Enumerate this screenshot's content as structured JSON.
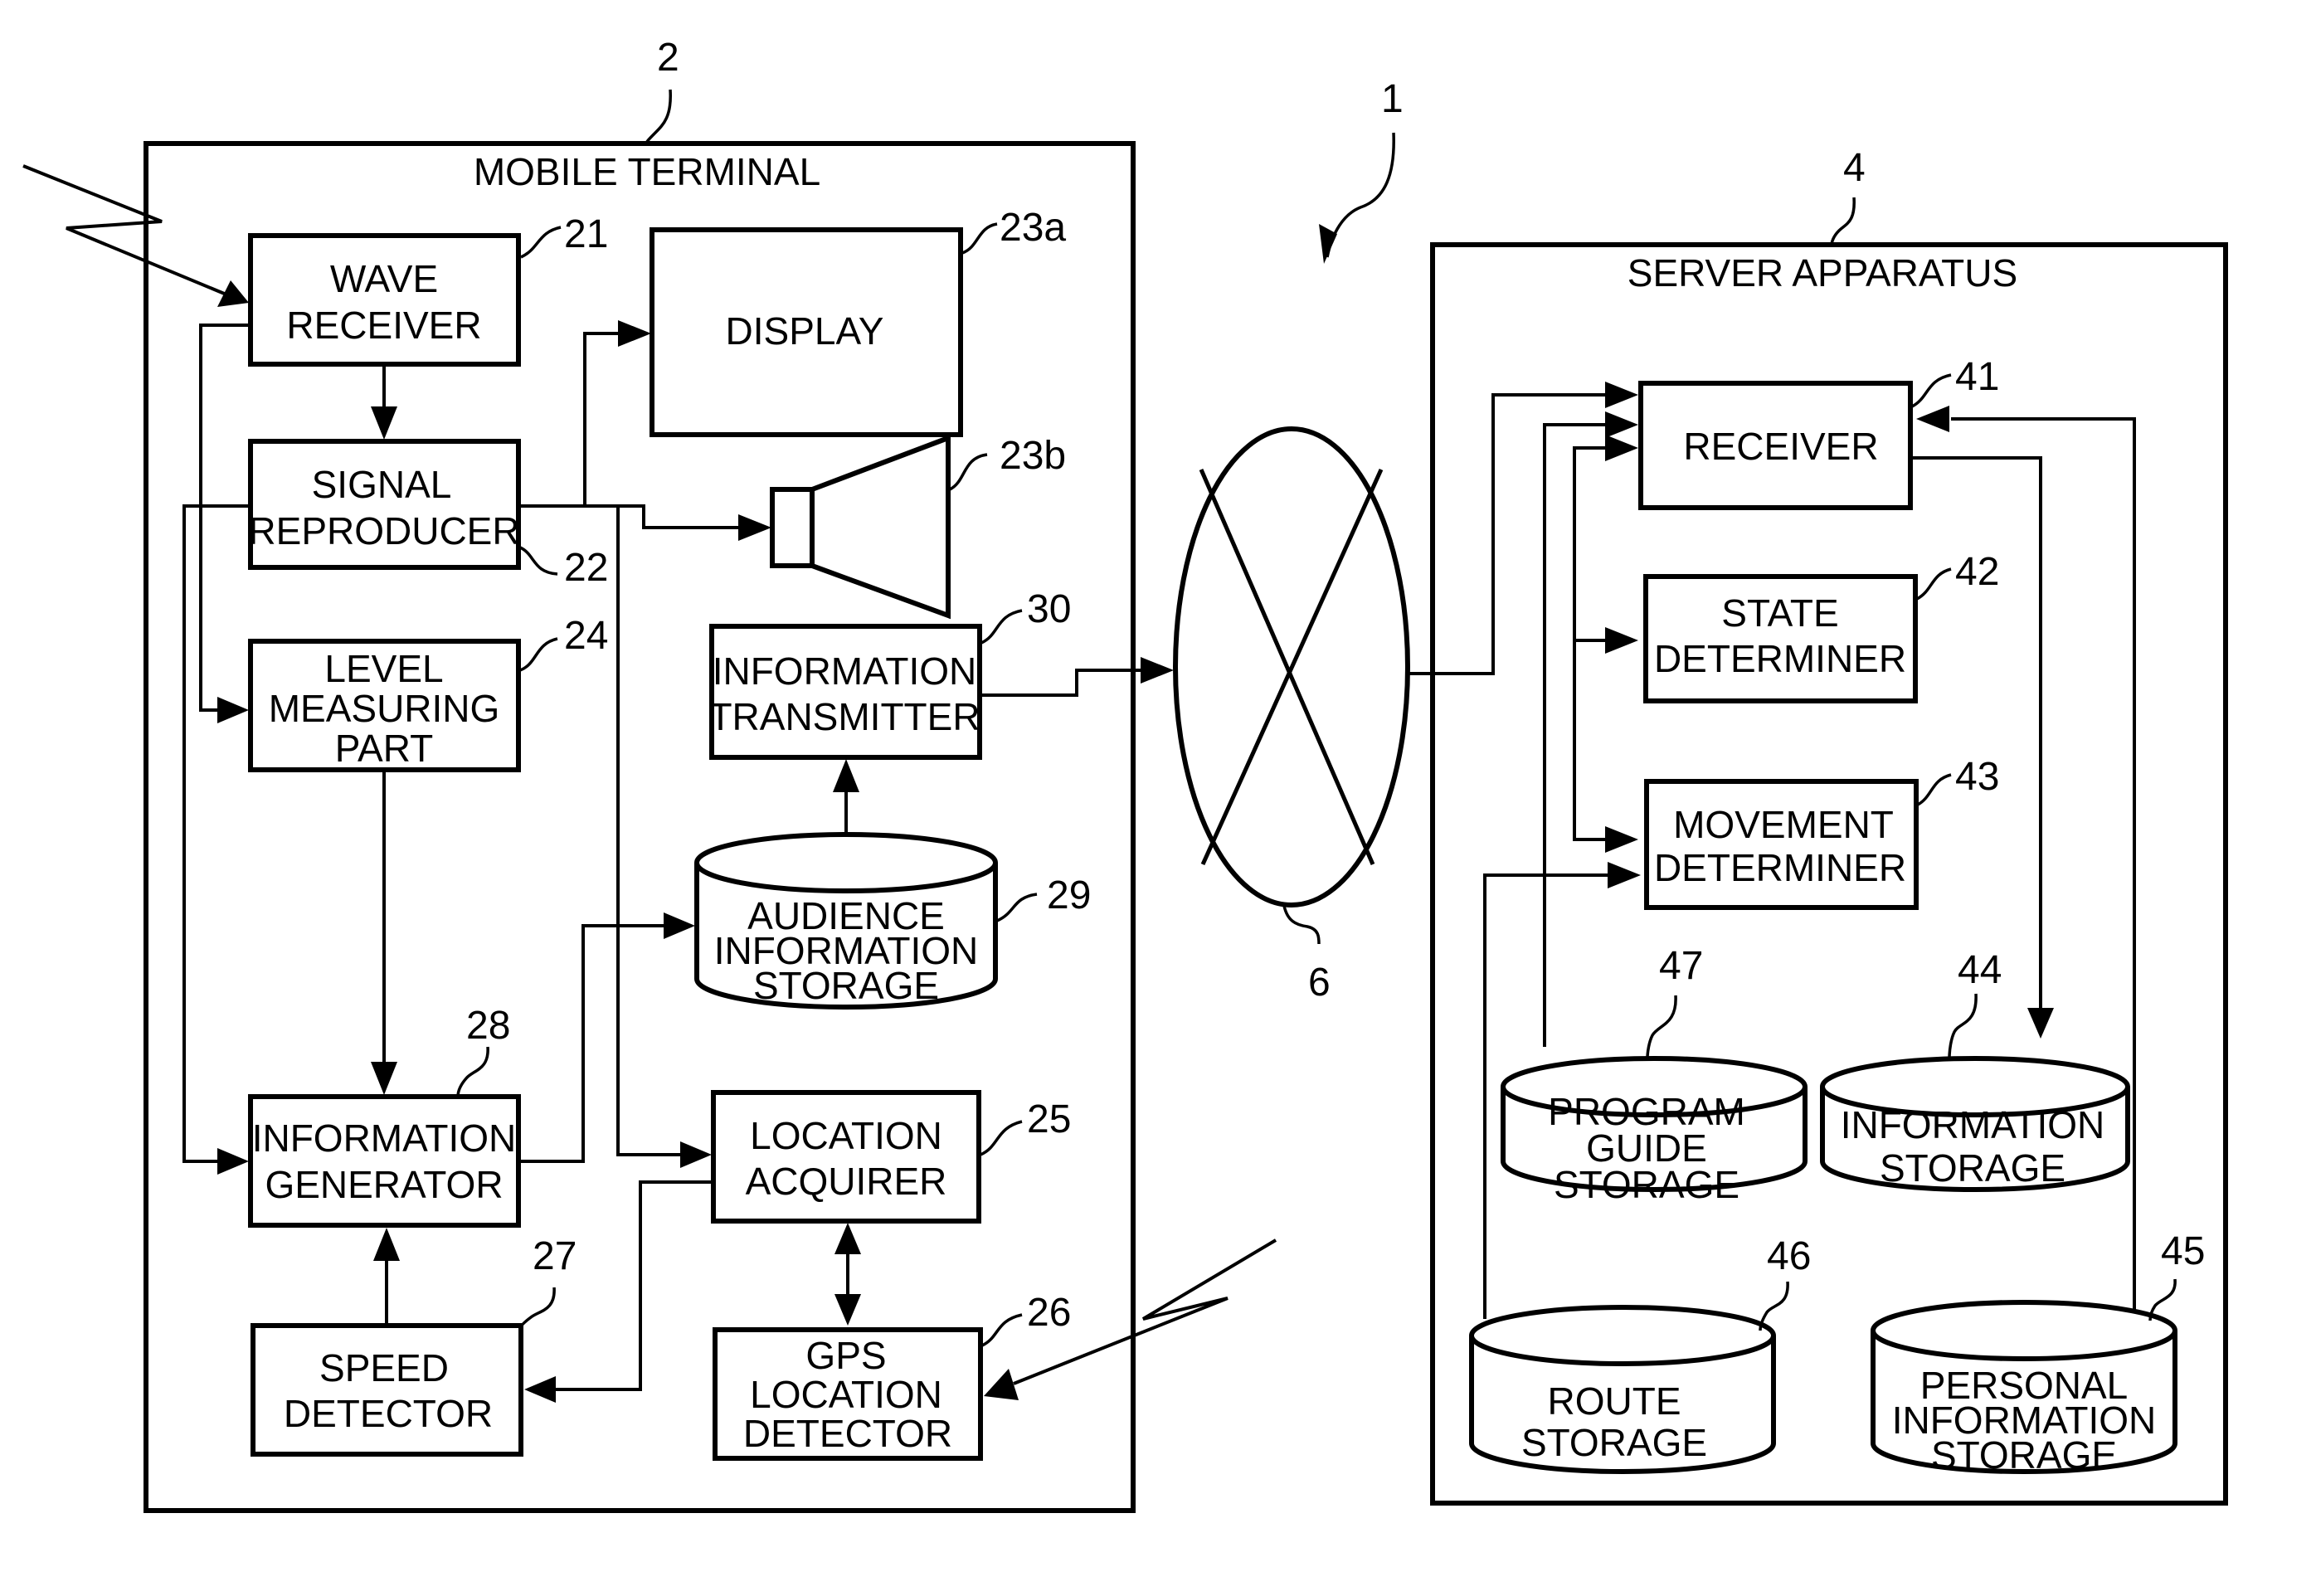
{
  "figure": {
    "system_ref": "1",
    "network_ref": "6"
  },
  "mobile_terminal": {
    "title": "MOBILE TERMINAL",
    "ref": "2",
    "blocks": {
      "wave_receiver": {
        "ref": "21",
        "lines": [
          "WAVE",
          "RECEIVER"
        ]
      },
      "signal_reproducer": {
        "ref": "22",
        "lines": [
          "SIGNAL",
          "REPRODUCER"
        ]
      },
      "display": {
        "ref": "23a",
        "lines": [
          "DISPLAY"
        ]
      },
      "speaker": {
        "ref": "23b"
      },
      "level_measuring_part": {
        "ref": "24",
        "lines": [
          "LEVEL",
          "MEASURING",
          "PART"
        ]
      },
      "location_acquirer": {
        "ref": "25",
        "lines": [
          "LOCATION",
          "ACQUIRER"
        ]
      },
      "gps_location_detector": {
        "ref": "26",
        "lines": [
          "GPS",
          "LOCATION",
          "DETECTOR"
        ]
      },
      "speed_detector": {
        "ref": "27",
        "lines": [
          "SPEED",
          "DETECTOR"
        ]
      },
      "information_generator": {
        "ref": "28",
        "lines": [
          "INFORMATION",
          "GENERATOR"
        ]
      },
      "audience_information_storage": {
        "ref": "29",
        "lines": [
          "AUDIENCE",
          "INFORMATION",
          "STORAGE"
        ]
      },
      "information_transmitter": {
        "ref": "30",
        "lines": [
          "INFORMATION",
          "TRANSMITTER"
        ]
      }
    }
  },
  "server_apparatus": {
    "title": "SERVER APPARATUS",
    "ref": "4",
    "blocks": {
      "receiver": {
        "ref": "41",
        "lines": [
          "RECEIVER"
        ]
      },
      "state_determiner": {
        "ref": "42",
        "lines": [
          "STATE",
          "DETERMINER"
        ]
      },
      "movement_determiner": {
        "ref": "43",
        "lines": [
          "MOVEMENT",
          "DETERMINER"
        ]
      },
      "information_storage": {
        "ref": "44",
        "lines": [
          "INFORMATION",
          "STORAGE"
        ]
      },
      "personal_information_storage": {
        "ref": "45",
        "lines": [
          "PERSONAL",
          "INFORMATION",
          "STORAGE"
        ]
      },
      "route_storage": {
        "ref": "46",
        "lines": [
          "ROUTE",
          "STORAGE"
        ]
      },
      "program_guide_storage": {
        "ref": "47",
        "lines": [
          "PROGRAM",
          "GUIDE",
          "STORAGE"
        ]
      }
    }
  }
}
